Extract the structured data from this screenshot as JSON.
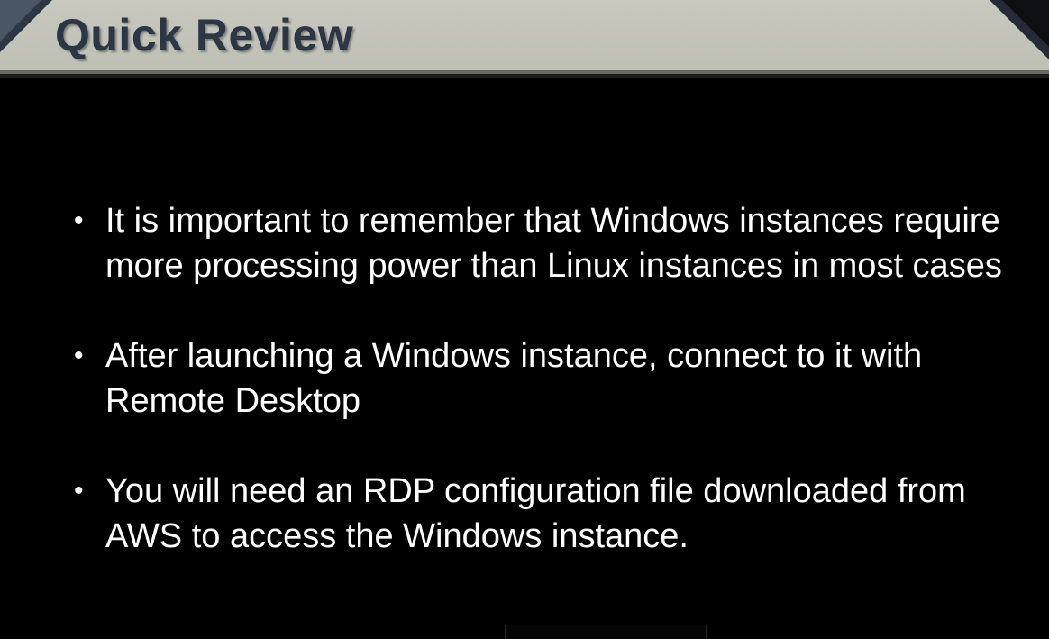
{
  "slide": {
    "title": "Quick Review",
    "bullets": [
      {
        "text": "It is important to remember that Windows instances require more processing power than Linux instances in most cases"
      },
      {
        "text": "After launching a Windows instance, connect to it with Remote Desktop"
      },
      {
        "text": "You will need an RDP configuration file downloaded from AWS to access the Windows instance."
      }
    ],
    "bullet_glyph": "•"
  },
  "colors": {
    "background": "#000000",
    "title_bar": "#c8c8be",
    "title_text": "#2b3646",
    "body_text": "#ffffff",
    "corner_accent": "#2c3645"
  }
}
